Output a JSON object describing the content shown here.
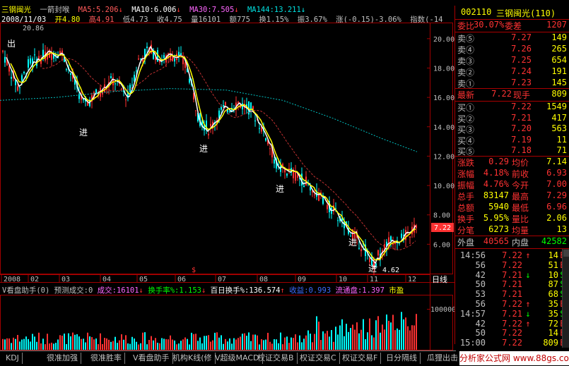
{
  "header": {
    "stock_name": "三钢闽光",
    "indicator": "一箭封喉",
    "ma5": "MA5:5.206",
    "ma10": "MA10:6.006",
    "ma30": "MA30:7.505",
    "ma144": "MA144:13.211",
    "date": "2008/11/03",
    "open": "开4.80",
    "high": "高4.91",
    "low": "低4.73",
    "close": "收4.75",
    "volume": "量16101",
    "amount": "额775",
    "turnover": "换1.15%",
    "amplitude": "振3.67%",
    "change": "涨(-0.15)-3.06%",
    "index": "指数(-14",
    "max_label": "20.86"
  },
  "price_axis": [
    "20.00",
    "18.00",
    "16.00",
    "14.00",
    "12.00",
    "10.00",
    "8.00",
    "6.00"
  ],
  "current_price_tag": "7.22",
  "date_axis": [
    "2008",
    "02",
    "03",
    "04",
    "05",
    "06",
    "07",
    "08",
    "09",
    "10",
    "11",
    "12"
  ],
  "period_button": "日线",
  "chart_annotations": {
    "out": "出",
    "in": "进",
    "low_label": "4.62",
    "dollar": "$"
  },
  "lower_header": {
    "title": "V看盘助手(0)",
    "forecast": "预测成交:0",
    "vol_label": "成交:",
    "vol_value": "16101",
    "turn_label": "换手率%:",
    "turn_value": "1.153",
    "hundred_label": "百日换手%:",
    "hundred_value": "136.574",
    "inflow_label": "收益:",
    "inflow_value": "0.993",
    "circ_label": "流通盘:",
    "circ_value": "1.397",
    "market_label": "市盈"
  },
  "volume_axis": "100000",
  "quote": {
    "code": "002110",
    "name": "三钢闽光(110)",
    "ratio_label": "委比",
    "ratio_value": "30.07%",
    "diff_label": "委差",
    "diff_value": "1207",
    "sells": [
      {
        "label": "卖⑤",
        "price": "7.27",
        "vol": "149"
      },
      {
        "label": "卖④",
        "price": "7.26",
        "vol": "265"
      },
      {
        "label": "卖③",
        "price": "7.25",
        "vol": "654"
      },
      {
        "label": "卖②",
        "price": "7.24",
        "vol": "191"
      },
      {
        "label": "卖①",
        "price": "7.23",
        "vol": "145"
      }
    ],
    "last_label": "最新",
    "last_value": "7.22",
    "now_label": "现手",
    "now_value": "809",
    "buys": [
      {
        "label": "买①",
        "price": "7.22",
        "vol": "1549"
      },
      {
        "label": "买②",
        "price": "7.21",
        "vol": "417"
      },
      {
        "label": "买③",
        "price": "7.20",
        "vol": "563"
      },
      {
        "label": "买④",
        "price": "7.19",
        "vol": "11"
      },
      {
        "label": "买⑤",
        "price": "7.18",
        "vol": "71"
      }
    ],
    "stats": [
      {
        "l1": "涨跌",
        "v1": "0.29",
        "l2": "均价",
        "v2": "7.14"
      },
      {
        "l1": "涨幅",
        "v1": "4.18%",
        "l2": "前收",
        "v2": "6.93"
      },
      {
        "l1": "振幅",
        "v1": "4.76%",
        "l2": "今开",
        "v2": "7.00"
      },
      {
        "l1": "总手",
        "v1": "83147",
        "l2": "最高",
        "v2": "7.29"
      },
      {
        "l1": "总额",
        "v1": "5940",
        "l2": "最低",
        "v2": "6.96"
      },
      {
        "l1": "换手",
        "v1": "5.95%",
        "l2": "量比",
        "v2": "2.06"
      },
      {
        "l1": "分笔",
        "v1": "6273",
        "l2": "均量",
        "v2": "13"
      }
    ],
    "outer_label": "外盘",
    "outer_value": "40565",
    "inner_label": "内盘",
    "inner_value": "42582"
  },
  "ticks": [
    {
      "time": "14:56",
      "price": "7.22",
      "arrow": "↑",
      "vol": "14",
      "side": "B"
    },
    {
      "time": "56",
      "price": "7.22",
      "arrow": "",
      "vol": "51",
      "side": "B"
    },
    {
      "time": "42",
      "price": "7.21",
      "arrow": "↓",
      "vol": "10",
      "side": "S"
    },
    {
      "time": "50",
      "price": "7.21",
      "arrow": "",
      "vol": "87",
      "side": "S"
    },
    {
      "time": "53",
      "price": "7.21",
      "arrow": "",
      "vol": "68",
      "side": "S"
    },
    {
      "time": "56",
      "price": "7.22",
      "arrow": "↑",
      "vol": "35",
      "side": "B"
    },
    {
      "time": "14:57",
      "price": "7.21",
      "arrow": "↓",
      "vol": "35",
      "side": "S"
    },
    {
      "time": "42",
      "price": "7.22",
      "arrow": "↑",
      "vol": "72",
      "side": "B"
    },
    {
      "time": "50",
      "price": "7.22",
      "arrow": "",
      "vol": "14",
      "side": "B"
    },
    {
      "time": "15:00",
      "price": "7.22",
      "arrow": "",
      "vol": "809",
      "side": "B"
    }
  ],
  "bottom_tabs": [
    "KDJ",
    "很准加强",
    "很准胜率",
    "V看盘助手",
    "机构K线(修",
    "V超级MACD",
    "权证交易B",
    "权证交易C",
    "权证交易F",
    "日分隔线",
    "瓜狸出击"
  ],
  "watermark": "分析家公式网 www.88gs.com",
  "colors": {
    "rise": "#ff3232",
    "fall": "#00ffff",
    "ma5": "#ffffff",
    "ma10": "#ffff00",
    "ma30": "#ff00ff",
    "ma144": "#00c0c0",
    "frame": "#a00000"
  }
}
